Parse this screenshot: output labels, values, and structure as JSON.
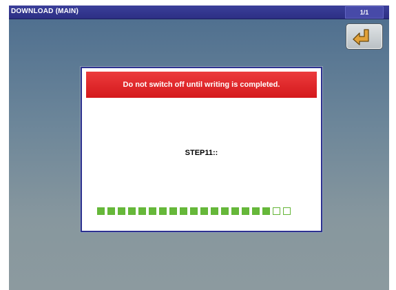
{
  "titlebar": {
    "title": "DOWNLOAD (MAIN)",
    "page_indicator": "1/1"
  },
  "back_button": {
    "icon": "return-arrow-icon"
  },
  "dialog": {
    "warning_text": "Do not switch off until writing is completed.",
    "step_text": "STEP11::",
    "progress": {
      "completed": 17,
      "total": 19
    }
  },
  "colors": {
    "title_bar": "#2c2f84",
    "warning_bg": "#e02a2d",
    "progress_fill": "#66b83a",
    "dialog_border": "#2d3190"
  }
}
